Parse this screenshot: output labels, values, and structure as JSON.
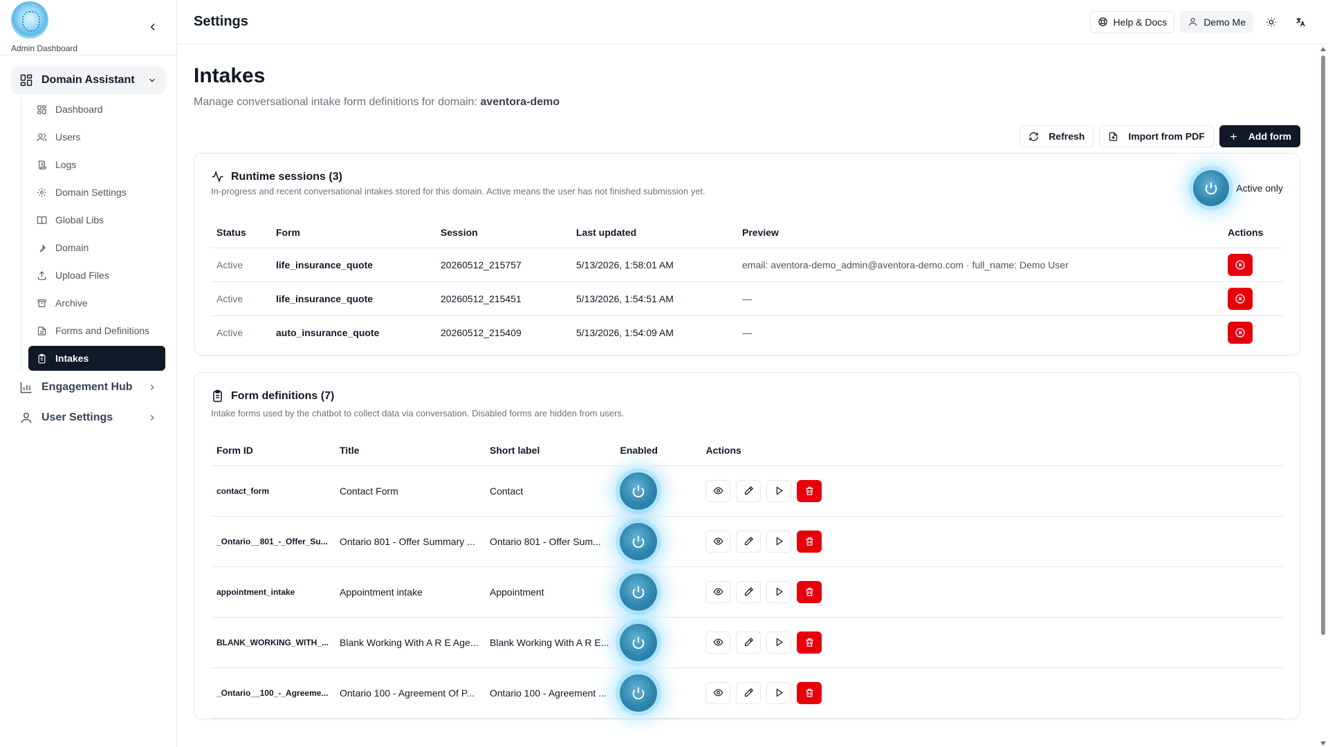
{
  "sidebar": {
    "brand": "Admin Dashboard",
    "groups": [
      {
        "label": "Domain Assistant",
        "icon": "grid-icon"
      },
      {
        "label": "Engagement Hub",
        "icon": "bar-chart-icon"
      },
      {
        "label": "User Settings",
        "icon": "user-icon"
      }
    ],
    "items": [
      {
        "label": "Dashboard",
        "icon": "grid-icon"
      },
      {
        "label": "Users",
        "icon": "users-icon"
      },
      {
        "label": "Logs",
        "icon": "scroll-icon"
      },
      {
        "label": "Domain Settings",
        "icon": "gear-icon"
      },
      {
        "label": "Global Libs",
        "icon": "book-icon"
      },
      {
        "label": "Domain",
        "icon": "wrench-icon"
      },
      {
        "label": "Upload Files",
        "icon": "upload-icon"
      },
      {
        "label": "Archive",
        "icon": "archive-icon"
      },
      {
        "label": "Forms and Definitions",
        "icon": "file-icon"
      },
      {
        "label": "Intakes",
        "icon": "clipboard-icon",
        "active": true
      }
    ]
  },
  "header": {
    "title": "Settings",
    "help": "Help & Docs",
    "user": "Demo Me"
  },
  "page": {
    "title": "Intakes",
    "subtitle_prefix": "Manage conversational intake form definitions for domain:",
    "domain": "aventora-demo",
    "buttons": {
      "refresh": "Refresh",
      "import": "Import from PDF",
      "add": "Add form"
    }
  },
  "sessions": {
    "title": "Runtime sessions (3)",
    "description": "In-progress and recent conversational intakes stored for this domain. Active means the user has not finished submission yet.",
    "toggle_label": "Active only",
    "columns": [
      "Status",
      "Form",
      "Session",
      "Last updated",
      "Preview",
      "Actions"
    ],
    "rows": [
      {
        "status": "Active",
        "form": "life_insurance_quote",
        "session": "20260512_215757",
        "updated": "5/13/2026, 1:58:01 AM",
        "preview": "email: aventora-demo_admin@aventora-demo.com · full_name: Demo User"
      },
      {
        "status": "Active",
        "form": "life_insurance_quote",
        "session": "20260512_215451",
        "updated": "5/13/2026, 1:54:51 AM",
        "preview": "—"
      },
      {
        "status": "Active",
        "form": "auto_insurance_quote",
        "session": "20260512_215409",
        "updated": "5/13/2026, 1:54:09 AM",
        "preview": "—"
      }
    ]
  },
  "forms": {
    "title": "Form definitions (7)",
    "description": "Intake forms used by the chatbot to collect data via conversation. Disabled forms are hidden from users.",
    "columns": [
      "Form ID",
      "Title",
      "Short label",
      "Enabled",
      "Actions"
    ],
    "rows": [
      {
        "id": "contact_form",
        "title": "Contact Form",
        "short": "Contact",
        "enabled": true
      },
      {
        "id": "_Ontario__801_-_Offer_Su...",
        "title": "Ontario 801 - Offer Summary ...",
        "short": "Ontario 801 - Offer Sum...",
        "enabled": true
      },
      {
        "id": "appointment_intake",
        "title": "Appointment intake",
        "short": "Appointment",
        "enabled": true
      },
      {
        "id": "BLANK_WORKING_WITH_...",
        "title": "Blank Working With A R E Age...",
        "short": "Blank Working With A R E...",
        "enabled": true
      },
      {
        "id": "_Ontario__100_-_Agreeme...",
        "title": "Ontario 100 - Agreement Of P...",
        "short": "Ontario 100 - Agreement ...",
        "enabled": true
      }
    ]
  },
  "colors": {
    "accent": "#111827",
    "danger": "#e7000b",
    "toggle": "#2f86ad",
    "glow": "#38bdf8"
  }
}
